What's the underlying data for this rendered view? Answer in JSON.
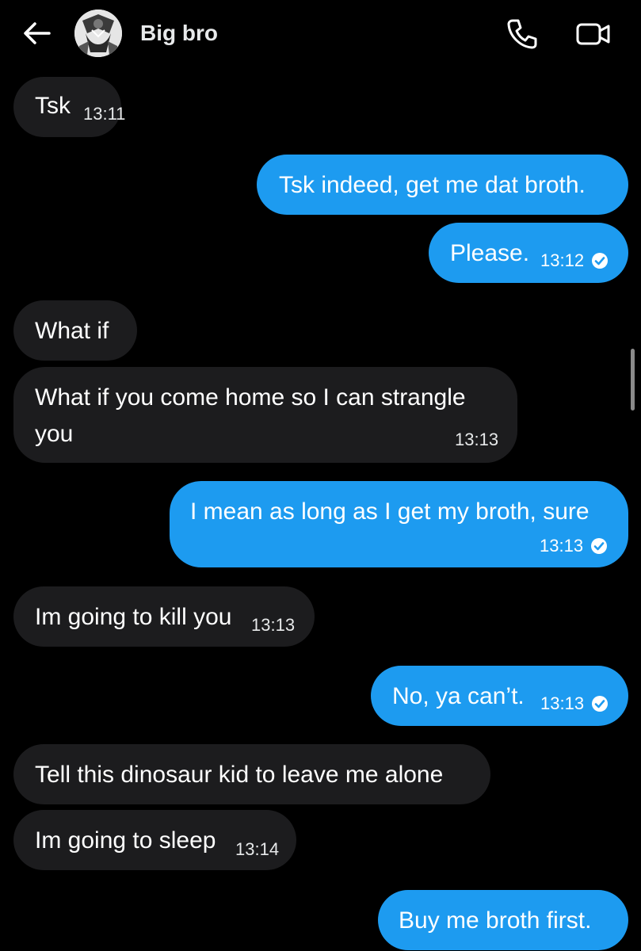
{
  "header": {
    "contact_name": "Big bro",
    "back_icon": "arrow-left-icon",
    "call_icon": "phone-icon",
    "video_icon": "video-camera-icon"
  },
  "colors": {
    "background": "#000000",
    "incoming_bubble": "#1c1c1e",
    "outgoing_bubble": "#1d9bf0",
    "text": "#ffffff"
  },
  "messages": [
    {
      "direction": "in",
      "text": "Tsk",
      "time": "13:11"
    },
    {
      "direction": "out",
      "text": "Tsk indeed, get me dat broth.",
      "time": ""
    },
    {
      "direction": "out",
      "text": "Please.",
      "time": "13:12",
      "read": true
    },
    {
      "direction": "in",
      "text": "What if",
      "time": ""
    },
    {
      "direction": "in",
      "text_line1": "What if you come home so I can strangle",
      "text_line2": "you",
      "time": "13:13"
    },
    {
      "direction": "out",
      "text": "I mean as long as I get my broth, sure",
      "time": "13:13",
      "read": true
    },
    {
      "direction": "in",
      "text": "Im going to kill you",
      "time": "13:13"
    },
    {
      "direction": "out",
      "text": "No, ya can’t.",
      "time": "13:13",
      "read": true
    },
    {
      "direction": "in",
      "text": "Tell this dinosaur kid to leave me alone",
      "time": ""
    },
    {
      "direction": "in",
      "text": "Im going to sleep",
      "time": "13:14"
    },
    {
      "direction": "out",
      "text": "Buy me broth first.",
      "time": ""
    }
  ]
}
